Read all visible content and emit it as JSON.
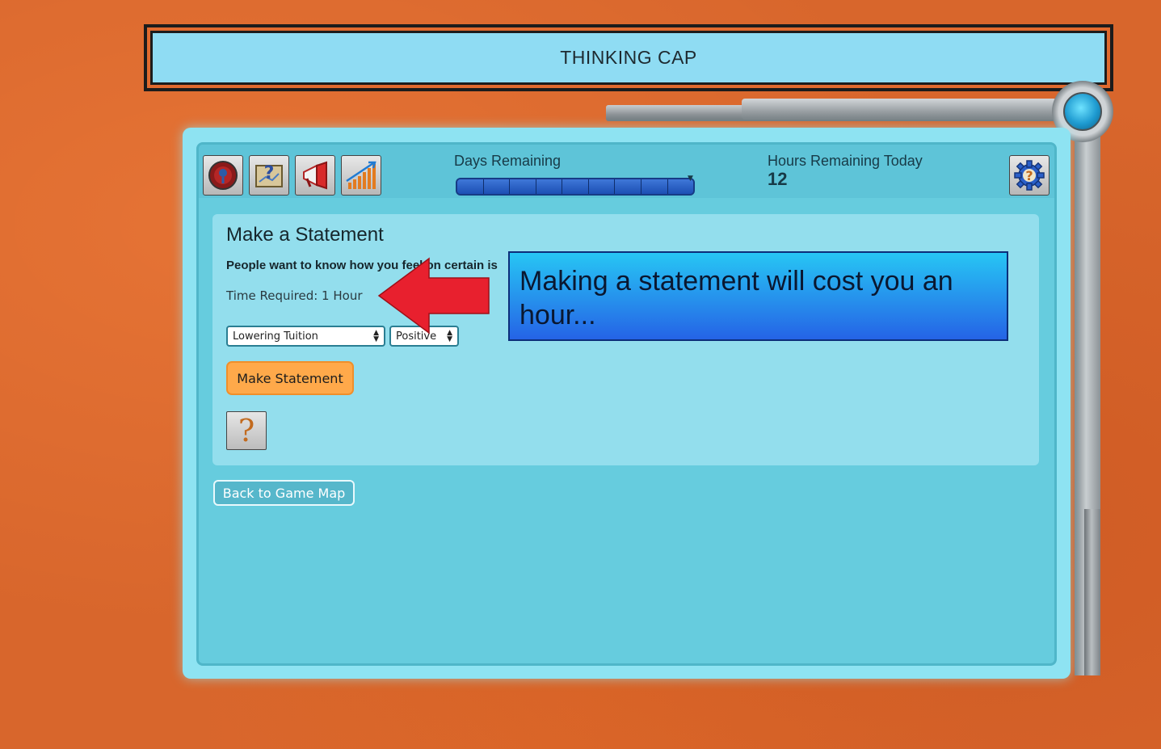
{
  "header": {
    "title": "THINKING CAP"
  },
  "topbar": {
    "nav_icons": [
      "target-icon",
      "map-help-icon",
      "megaphone-icon",
      "chart-icon"
    ],
    "days_label": "Days Remaining",
    "days_segments": 9,
    "hours_label": "Hours Remaining Today",
    "hours_value": "12",
    "settings_icon": "gear-help-icon"
  },
  "card": {
    "title": "Make a Statement",
    "description": "People want to know how you feel on certain is",
    "time_required": "Time Required: 1 Hour",
    "issue_select": {
      "value": "Lowering Tuition"
    },
    "stance_select": {
      "value": "Positive"
    },
    "make_button": "Make Statement",
    "help_icon": "question-mark-icon"
  },
  "back_button": "Back to Game Map",
  "tutorial": {
    "tip_text": "Making a statement will cost you an hour...",
    "arrow_color": "#e8202e"
  },
  "colors": {
    "background": "#d8662c",
    "panel": "#8ee3f2",
    "accent_button": "#ffa94a",
    "tip_top": "#27c6f4",
    "tip_bottom": "#2563e6"
  }
}
